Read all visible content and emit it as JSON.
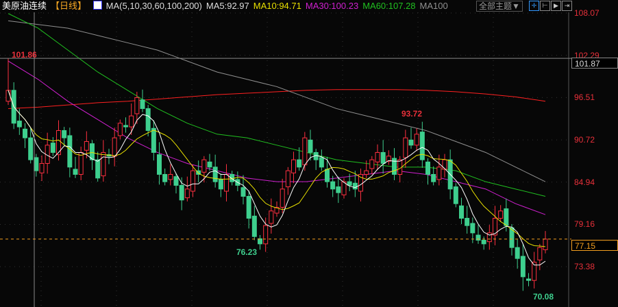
{
  "header": {
    "title": "美原油连续",
    "period": "【日线】",
    "ma_label": "MA(5,10,30,60,100,200)",
    "ma5": "MA5:92.97",
    "ma10": "MA10:94.71",
    "ma30": "MA30:100.23",
    "ma60": "MA60:107.28",
    "ma100": "MA100",
    "theme": "全部主题▼"
  },
  "colors": {
    "up": "#ff3040",
    "down": "#3ecf8e",
    "ma5": "#ffffff",
    "ma10": "#e8e000",
    "ma30": "#d020d0",
    "ma60": "#20c020",
    "ma100": "#909090",
    "ma200": "#ff2020"
  },
  "chart_data": {
    "type": "candlestick",
    "ylim": [
      68.5,
      109.5
    ],
    "yticks": [
      "108.07",
      "102.29",
      "96.51",
      "90.72",
      "84.94",
      "79.16",
      "73.38"
    ],
    "crosshair_price": "101.87",
    "last_price": "77.15",
    "annotations": {
      "high1": "101.86",
      "high2": "93.72",
      "low1": "76.23",
      "low2": "70.08"
    },
    "closes": [
      97.5,
      93,
      92.5,
      91,
      88,
      86.5,
      87.5,
      90,
      89,
      92,
      91,
      87,
      86,
      89,
      90.5,
      88,
      85.5,
      89,
      88.5,
      91,
      93,
      92.5,
      94,
      96.5,
      95,
      92,
      89,
      86,
      85,
      86,
      84.5,
      82.5,
      84,
      86.5,
      86,
      88,
      87,
      85,
      84,
      86,
      85,
      84.5,
      83,
      80,
      77.5,
      76.5,
      79,
      81,
      81.5,
      84,
      86.5,
      88,
      87,
      91,
      89,
      88,
      87,
      85,
      84,
      83.5,
      85,
      84.5,
      84,
      86,
      86.5,
      88,
      89,
      87.5,
      88.5,
      86,
      88,
      91,
      90,
      91.5,
      88,
      86,
      85,
      87,
      88,
      84,
      82,
      80,
      79,
      78,
      77,
      76.5,
      78,
      80,
      81,
      79,
      76,
      74.5,
      72,
      71.5,
      74,
      76,
      77.15
    ],
    "ma30": [
      101.5,
      99,
      96,
      93.5,
      91,
      89,
      87.5,
      86.5,
      85.5,
      85,
      85,
      85.5,
      86,
      86.5,
      86,
      85,
      84,
      82,
      80.5
    ],
    "ma60": [
      108,
      106,
      103,
      100,
      97.5,
      95,
      93,
      91.5,
      91,
      90,
      89,
      88,
      87.5,
      87,
      87,
      86.5,
      85,
      84,
      83
    ],
    "ma100": [
      107,
      106.5,
      106,
      105,
      104,
      103,
      101.5,
      100,
      99,
      98,
      96.5,
      95,
      94,
      93,
      92,
      90.5,
      89,
      87,
      85
    ],
    "ma200": [
      95,
      95.2,
      95.5,
      95.8,
      96,
      96.3,
      96.6,
      96.9,
      97.1,
      97.3,
      97.5,
      97.6,
      97.6,
      97.6,
      97.5,
      97.3,
      97,
      96.6,
      96
    ]
  }
}
